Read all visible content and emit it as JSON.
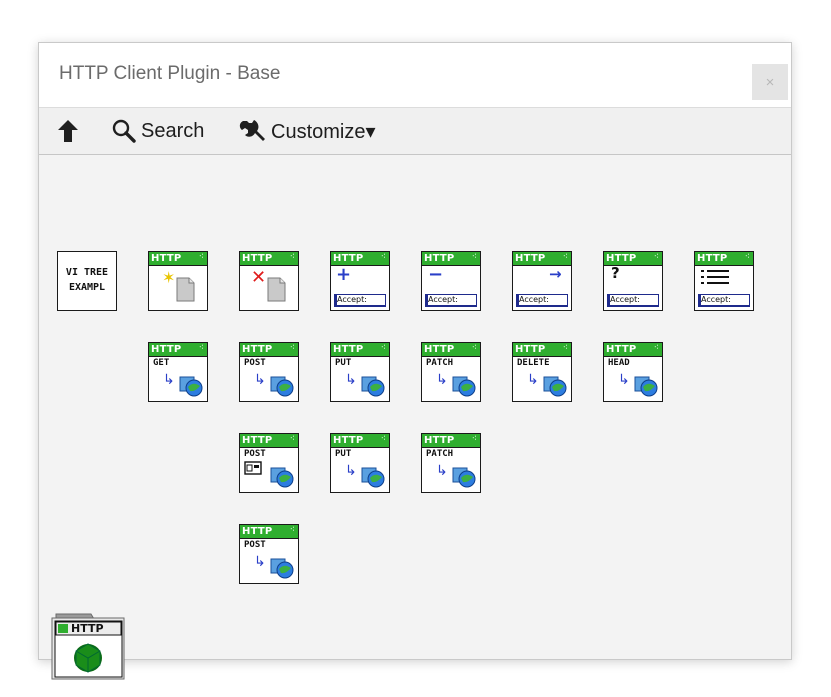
{
  "window": {
    "title": "HTTP Client Plugin - Base",
    "close_glyph": "×"
  },
  "toolbar": {
    "up_icon": "up-arrow-icon",
    "search_label": "Search",
    "customize_label": "Customize▾"
  },
  "palette": {
    "header_text": "HTTP",
    "accept_text": "Accept:",
    "vitree": {
      "line1": "VI TREE",
      "line2": "EXAMPL"
    },
    "row2": [
      "GET",
      "POST",
      "PUT",
      "PATCH",
      "DELETE",
      "HEAD"
    ],
    "row3": [
      "POST",
      "PUT",
      "PATCH"
    ],
    "row4": [
      "POST"
    ],
    "library_label": "HTTP"
  },
  "colors": {
    "header_green": "#2fae2f",
    "accent_blue": "#1e2a8c",
    "title_gray": "#6b6b6b"
  }
}
